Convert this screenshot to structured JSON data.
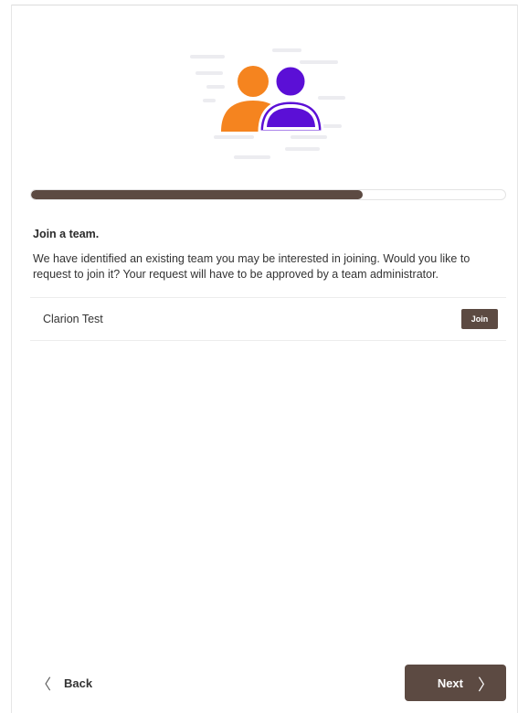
{
  "progress": {
    "fraction": 0.7
  },
  "section": {
    "title": "Join a team.",
    "description": "We have identified an existing team you may be interested in joining. Would you like to request to join it? Your request will have to be approved by a team administrator."
  },
  "teams": [
    {
      "name": "Clarion Test",
      "join_label": "Join"
    }
  ],
  "navigation": {
    "back_label": "Back",
    "next_label": "Next",
    "back_icon": "chevron-left-icon",
    "next_icon": "chevron-right-icon"
  },
  "colors": {
    "primary": "#5c4a42",
    "person_orange": "#f5841f",
    "person_purple": "#5b0fd6"
  },
  "icons": {
    "illustration": "team-people-illustration"
  }
}
